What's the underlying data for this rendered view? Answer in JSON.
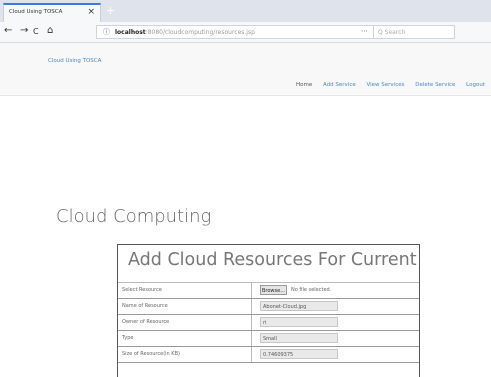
{
  "browser": {
    "tab_title": "Cloud Using TOSCA",
    "tab_close": "×",
    "new_tab": "+",
    "nav": {
      "back": "←",
      "forward": "→",
      "reload": "C",
      "home": "⌂"
    },
    "url_info_icon": "ⓘ",
    "url_host": "localhost",
    "url_path": ":8080/cloudcomputing/resources.jsp",
    "url_actions": "⋯ ♡ ☆",
    "search_placeholder": "Q  Search"
  },
  "app": {
    "brand": "Cloud Using TOSCA",
    "menu": [
      "Home",
      "Add Service",
      "View Services",
      "Delete Service",
      "Logout"
    ]
  },
  "main": {
    "heading": "Cloud Computing",
    "panel_title": "Add Cloud Resources For Current User",
    "rows": [
      {
        "label": "Select Resource",
        "type": "file",
        "button": "Browse...",
        "note": "No file selected."
      },
      {
        "label": "Name of Resource",
        "type": "text",
        "value": "Abonet-Cloud.jpg"
      },
      {
        "label": "Owner of Resource",
        "type": "text",
        "value": "ri"
      },
      {
        "label": "Type",
        "type": "text",
        "value": "Small"
      },
      {
        "label": "Size of Resource(in KB)",
        "type": "text",
        "value": "0.74609375"
      }
    ]
  }
}
